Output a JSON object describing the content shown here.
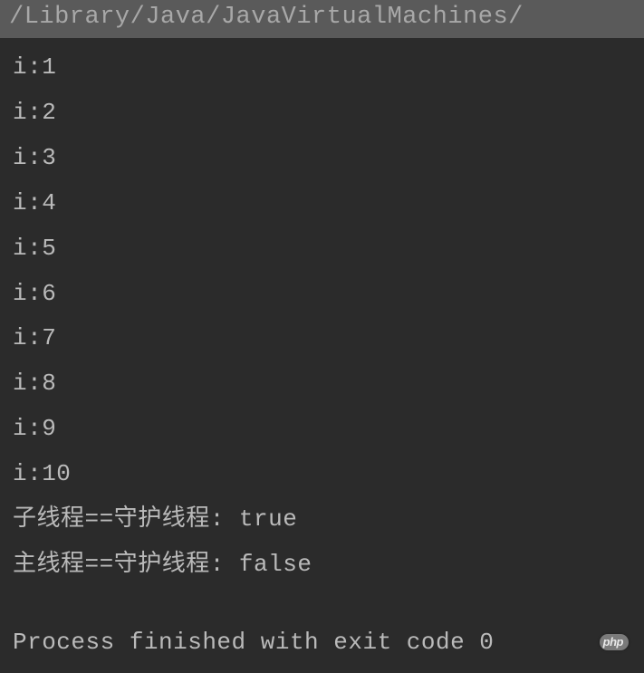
{
  "header": {
    "path": "/Library/Java/JavaVirtualMachines/"
  },
  "output": {
    "lines": [
      "i:1",
      "i:2",
      "i:3",
      "i:4",
      "i:5",
      "i:6",
      "i:7",
      "i:8",
      "i:9",
      "i:10",
      "子线程==守护线程: true",
      "主线程==守护线程: false"
    ],
    "exit_message": "Process finished with exit code 0"
  },
  "watermark": {
    "text": "php",
    "suffix": ""
  }
}
